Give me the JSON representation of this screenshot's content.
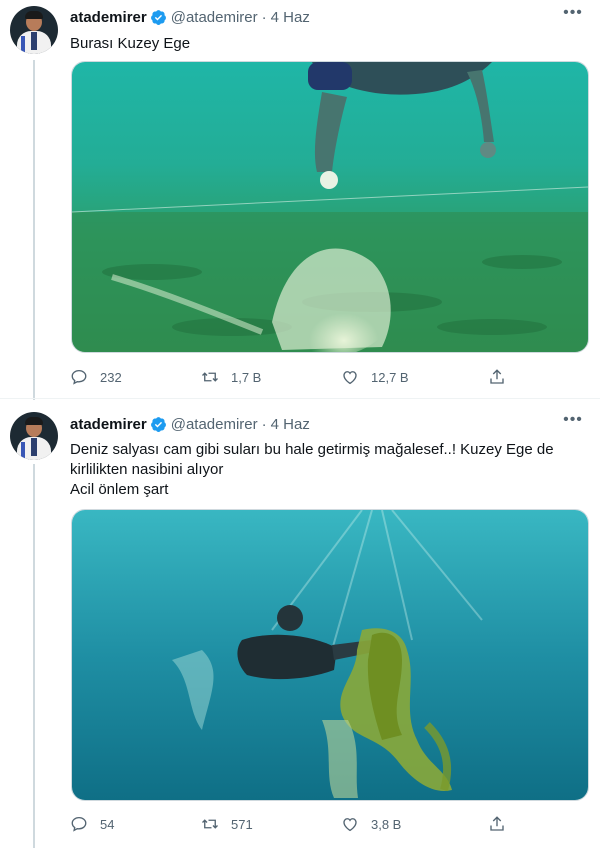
{
  "tweets": [
    {
      "author": {
        "name": "atademirer",
        "handle": "@atademirer"
      },
      "date": "4 Haz",
      "text": [
        "Burası Kuzey Ege"
      ],
      "stats": {
        "replies": "232",
        "retweets": "1,7 B",
        "likes": "12,7 B"
      }
    },
    {
      "author": {
        "name": "atademirer",
        "handle": "@atademirer"
      },
      "date": "4 Haz",
      "text": [
        "Deniz salyası cam gibi suları bu hale getirmiş mağalesef..! Kuzey Ege de kirlilikten nasibini alıyor",
        "Acil önlem şart"
      ],
      "stats": {
        "replies": "54",
        "retweets": "571",
        "likes": "3,8 B"
      }
    }
  ],
  "separator": "·",
  "icons": {
    "verified": "verified-badge-icon",
    "more": "more-options-icon",
    "reply": "reply-icon",
    "retweet": "retweet-icon",
    "like": "like-icon",
    "share": "share-icon"
  },
  "colors": {
    "verified": "#1d9bf0",
    "secondary_text": "#536471",
    "thread_line": "#cfd9de"
  }
}
